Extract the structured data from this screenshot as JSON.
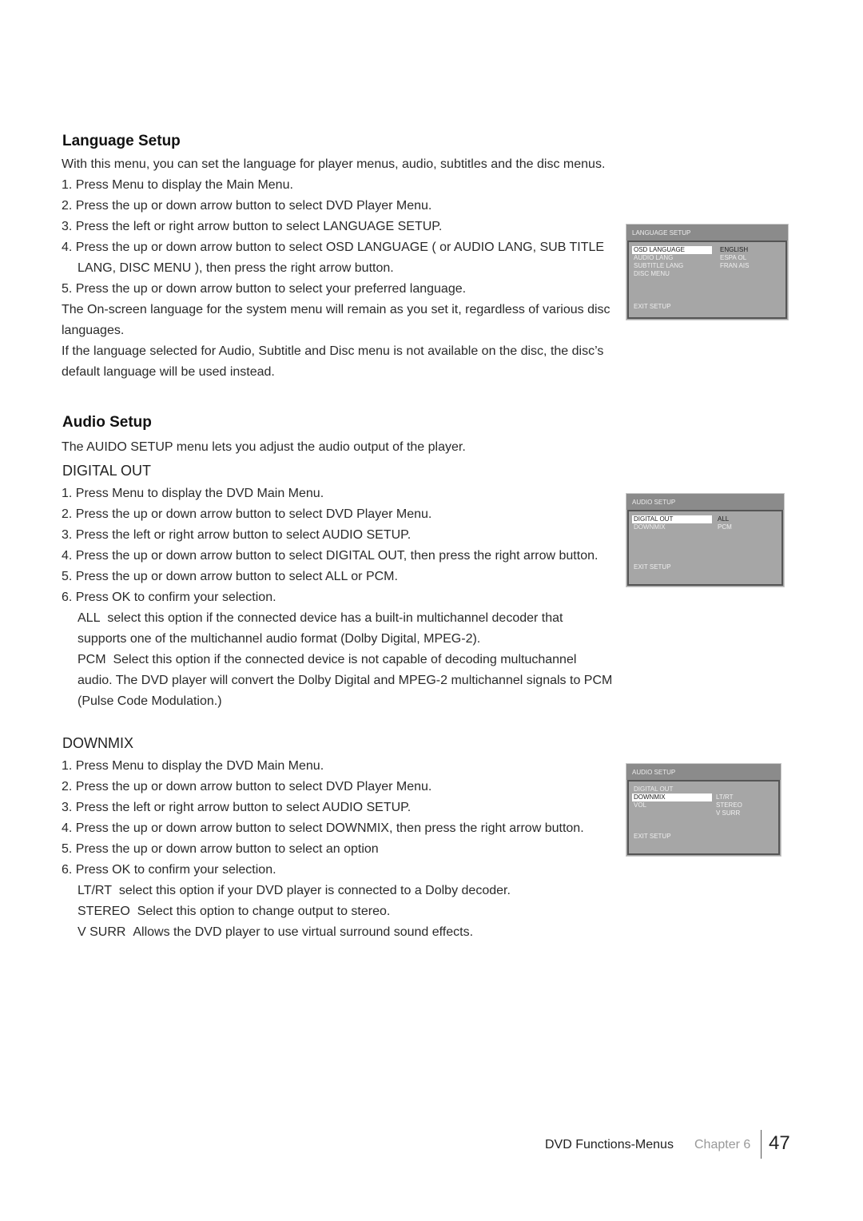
{
  "language": {
    "title": "Language Setup",
    "intro": "With this menu, you can set the language for player menus, audio, subtitles and the disc menus.",
    "steps": [
      "1. Press Menu to display the Main Menu.",
      "2. Press the up or down arrow button to select DVD Player Menu.",
      "3. Press the left or right arrow button to select LANGUAGE SETUP.",
      "4. Press the up or down arrow button to select OSD LANGUAGE ( or AUDIO LANG, SUB TITLE LANG, DISC MENU ), then press the right arrow button.",
      "5. Press the up or down arrow button to select your preferred language."
    ],
    "note1": "The On-screen language for the system menu will remain as you set it, regardless of various disc languages.",
    "note2": "If the language selected for Audio, Subtitle and Disc menu is not available on the disc, the disc’s default language will be used instead."
  },
  "audio": {
    "title": "Audio Setup",
    "intro": "The AUIDO SETUP menu lets you adjust the audio output of the player.",
    "digital": {
      "title": "DIGITAL OUT",
      "steps": [
        "1. Press Menu to display the DVD Main Menu.",
        "2. Press the up or down arrow button to select DVD Player Menu.",
        "3. Press the left or right arrow button to select AUDIO SETUP.",
        "4. Press the up or down arrow button to select DIGITAL OUT, then press the right arrow button.",
        "5. Press the up or down arrow button to select ALL or PCM.",
        "6. Press OK to confirm your selection."
      ],
      "options": [
        {
          "name": "ALL",
          "desc": "select this option if the connected device has a built-in multichannel decoder that supports one of the multichannel audio format (Dolby Digital, MPEG-2)."
        },
        {
          "name": "PCM",
          "desc": "Select this option if the connected device is not capable of decoding multuchannel audio. The DVD player will convert the Dolby Digital and MPEG-2 multichannel signals to PCM (Pulse Code Modulation.)"
        }
      ]
    },
    "downmix": {
      "title": "DOWNMIX",
      "steps": [
        "1. Press Menu to display the DVD Main Menu.",
        "2. Press the up or down arrow button to select DVD Player Menu.",
        "3. Press the left or right arrow button to select AUDIO SETUP.",
        "4. Press the up or down arrow button to select DOWNMIX, then press the right arrow button.",
        "5. Press the up or down arrow button to select an option",
        "6. Press OK to confirm your selection."
      ],
      "options": [
        {
          "name": "LT/RT",
          "desc": "select this option if your DVD player is connected to a Dolby decoder."
        },
        {
          "name": "STEREO",
          "desc": "Select this option to change output to stereo."
        },
        {
          "name": "V SURR",
          "desc": "Allows the DVD player to use virtual surround sound effects."
        }
      ]
    }
  },
  "menus": [
    {
      "title": "LANGUAGE SETUP",
      "items": [
        "OSD LANGUAGE",
        "AUDIO  LANG",
        "SUBTITLE  LANG",
        "DISC MENU"
      ],
      "values": [
        "ENGLISH",
        "ESPA OL",
        "FRAN AIS"
      ],
      "exit": "EXIT SETUP"
    },
    {
      "title": "AUDIO SETUP",
      "items": [
        "DIGITAL OUT",
        "DOWNMIX"
      ],
      "values": [
        "ALL",
        "PCM"
      ],
      "exit": "EXIT SETUP"
    },
    {
      "title": "AUDIO SETUP",
      "items": [
        "DIGITAL OUT",
        "DOWNMIX",
        "VOL"
      ],
      "values": [
        "LT/RT",
        "STEREO",
        "V SURR"
      ],
      "exit": "EXIT SETUP"
    }
  ],
  "footer": {
    "section": "DVD Functions-Menus",
    "chapter": "Chapter 6",
    "page": "47"
  }
}
